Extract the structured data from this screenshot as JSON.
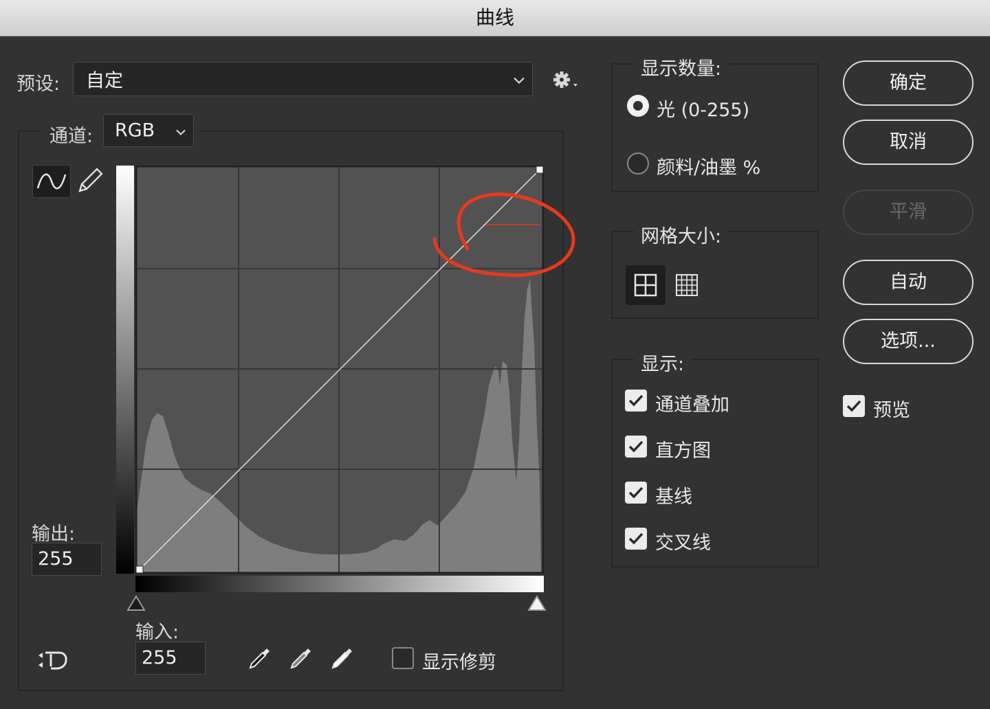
{
  "window": {
    "title": "曲线"
  },
  "preset": {
    "label": "预设:",
    "value": "自定"
  },
  "channel": {
    "label": "通道:",
    "value": "RGB"
  },
  "output": {
    "label": "输出:",
    "value": "255"
  },
  "input": {
    "label": "输入:",
    "value": "255"
  },
  "show_clipping": {
    "label": "显示修剪",
    "checked": false
  },
  "show_amount": {
    "legend": "显示数量:",
    "options": [
      {
        "label": "光 (0-255)",
        "selected": true
      },
      {
        "label": "颜料/油墨 %",
        "selected": false
      }
    ]
  },
  "grid_size": {
    "legend": "网格大小:"
  },
  "display": {
    "legend": "显示:",
    "options": [
      {
        "label": "通道叠加",
        "checked": true
      },
      {
        "label": "直方图",
        "checked": true
      },
      {
        "label": "基线",
        "checked": true
      },
      {
        "label": "交叉线",
        "checked": true
      }
    ]
  },
  "buttons": {
    "ok": "确定",
    "cancel": "取消",
    "smooth": "平滑",
    "auto": "自动",
    "options": "选项..."
  },
  "preview": {
    "label": "预览",
    "checked": true
  },
  "colors": {
    "accent_annotation": "#e8391d",
    "panel": "#323232",
    "graph_bg": "#525252"
  },
  "curve": {
    "points": [
      [
        0,
        0
      ],
      [
        255,
        255
      ]
    ]
  }
}
